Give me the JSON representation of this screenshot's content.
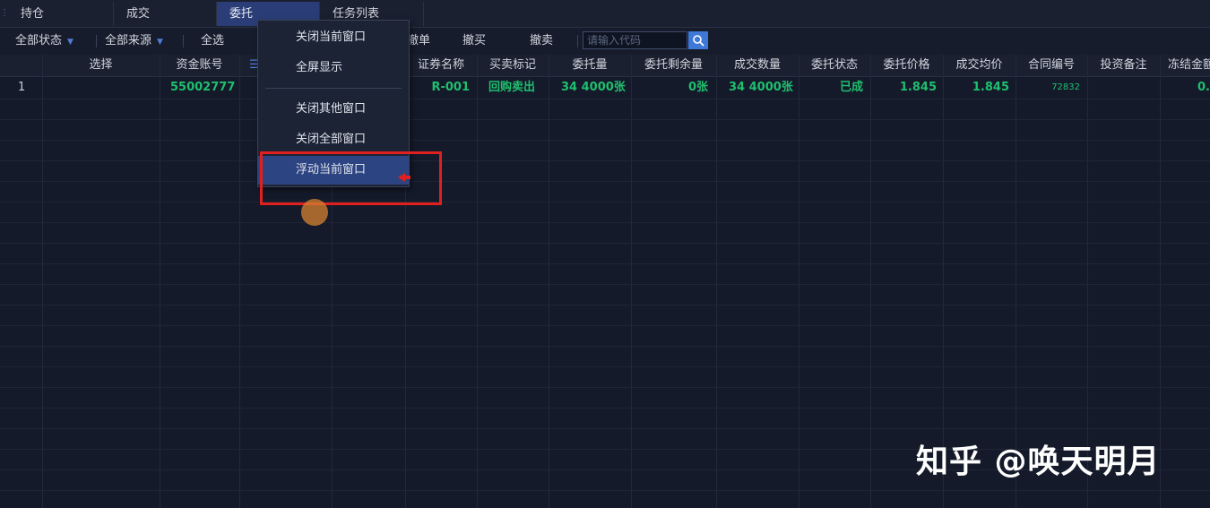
{
  "tabs": [
    {
      "label": "持仓"
    },
    {
      "label": "成交"
    },
    {
      "label": "委托"
    },
    {
      "label": "任务列表"
    }
  ],
  "toolbar": {
    "status_filter": "全部状态",
    "source_filter": "全部来源",
    "select_all": "全选",
    "cancel_order": "撤单",
    "cancel_buy": "撤买",
    "cancel_sell": "撤卖",
    "search_placeholder": "请输入代码"
  },
  "table": {
    "columns": [
      "选择",
      "资金账号",
      "证券名称",
      "买卖标记",
      "委托量",
      "委托剩余量",
      "成交数量",
      "委托状态",
      "委托价格",
      "成交均价",
      "合同编号",
      "投资备注",
      "冻结金额"
    ],
    "rows": [
      {
        "index": "1",
        "account": "55002777",
        "security": "R-001",
        "side": "回购卖出",
        "order_qty": "34 4000张",
        "remaining_qty": "0张",
        "filled_qty": "34 4000张",
        "status": "已成",
        "order_price": "1.845",
        "avg_price": "1.845",
        "contract_no": "72832",
        "note": "",
        "frozen": "0."
      }
    ]
  },
  "context_menu": {
    "items": [
      {
        "label": "关闭当前窗口"
      },
      {
        "label": "全屏显示"
      },
      {
        "label": "关闭其他窗口"
      },
      {
        "label": "关闭全部窗口"
      },
      {
        "label": "浮动当前窗口"
      }
    ]
  },
  "watermark": "知乎 @唤天明月",
  "colors": {
    "background": "#141a2a",
    "accent": "#3f79d8",
    "highlight": "#2d4482",
    "green": "#1fbf6e",
    "annotation_red": "#e0201e"
  }
}
